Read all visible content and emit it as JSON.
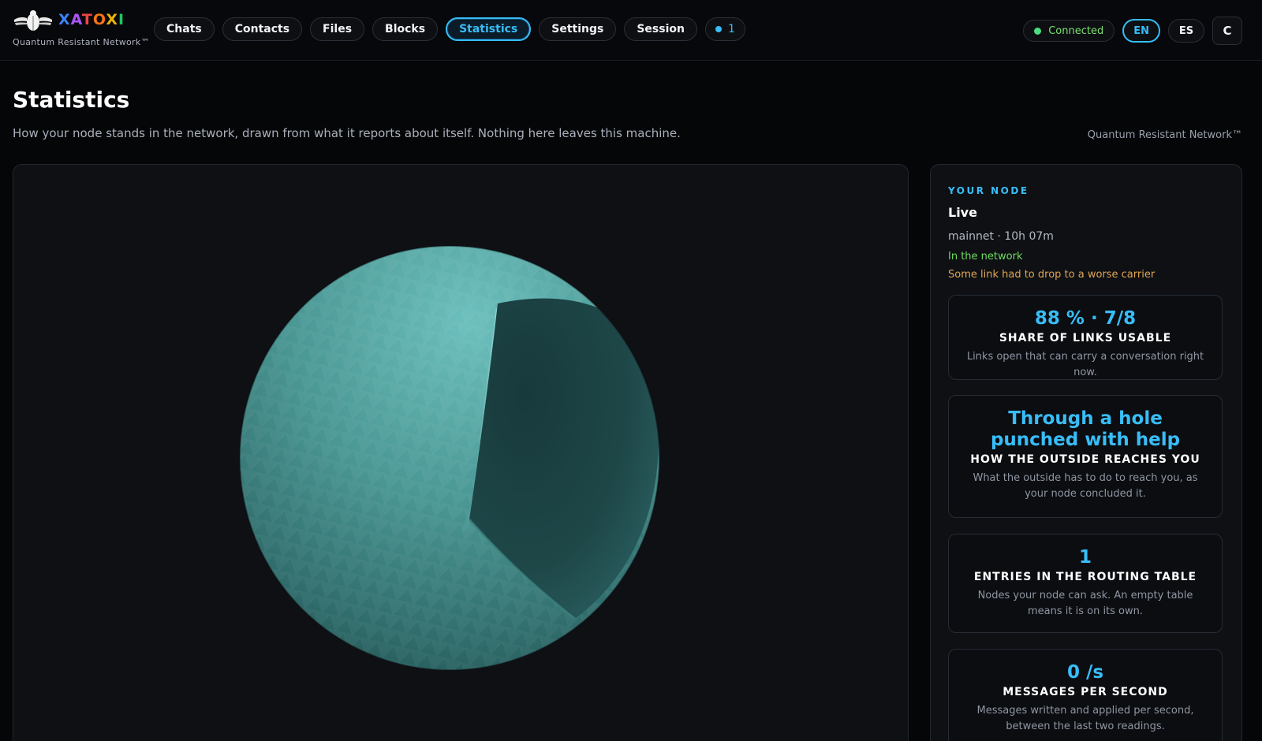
{
  "brand": {
    "letters": [
      "X",
      "A",
      "T",
      "O",
      "X",
      "I"
    ],
    "tagline": "Quantum Resistant Network™"
  },
  "nav": {
    "items": [
      "Chats",
      "Contacts",
      "Files",
      "Blocks",
      "Statistics",
      "Settings",
      "Session"
    ],
    "active": "Statistics",
    "notification_count": "1"
  },
  "header_right": {
    "status": "Connected",
    "lang_en": "EN",
    "lang_es": "ES",
    "theme_label": "C"
  },
  "page": {
    "title": "Statistics",
    "subtitle": "How your node stands in the network, drawn from what it reports about itself. Nothing here leaves this machine.",
    "tag": "Quantum Resistant Network™"
  },
  "node": {
    "eyebrow": "YOUR NODE",
    "state": "Live",
    "meta": "mainnet · 10h 07m",
    "in_network": "In the network",
    "warning": "Some link had to drop to a worse carrier"
  },
  "stats": [
    {
      "value": "88 % · 7/8",
      "label": "SHARE OF LINKS USABLE",
      "desc": "Links open that can carry a conversation right now."
    },
    {
      "value": "Through a hole punched with help",
      "label": "HOW THE OUTSIDE REACHES YOU",
      "desc": "What the outside has to do to reach you, as your node concluded it."
    },
    {
      "value": "1",
      "label": "ENTRIES IN THE ROUTING TABLE",
      "desc": "Nodes your node can ask. An empty table means it is on its own."
    },
    {
      "value": "0 /s",
      "label": "MESSAGES PER SECOND",
      "desc": "Messages written and applied per second, between the last two readings."
    }
  ],
  "colors": {
    "accent": "#38bdf8",
    "ok": "#4ade80",
    "warn": "#e0a552",
    "sphere": "#4a9a98"
  },
  "icons": {
    "logo": "winged-scarab-logo-icon",
    "status": "status-dot-icon",
    "notification": "notification-dot-icon"
  }
}
